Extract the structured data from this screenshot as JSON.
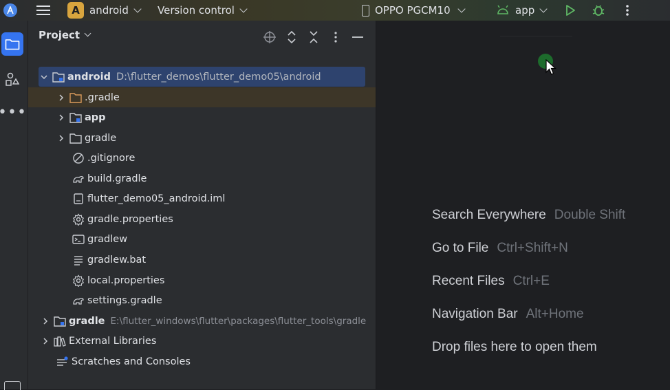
{
  "topbar": {
    "project_initial": "A",
    "project_name": "android",
    "vcs_label": "Version control",
    "device_name": "OPPO PGCM10",
    "run_config": "app",
    "icons": [
      "main-menu-icon",
      "phone-icon",
      "android-icon",
      "run-icon",
      "debug-icon",
      "more-vertical-icon"
    ]
  },
  "left_strip": {
    "items": [
      "project-tool-icon",
      "structure-icon",
      "more-tools-icon"
    ]
  },
  "panel": {
    "title": "Project",
    "header_icons": [
      "locate-icon",
      "expand-all-icon",
      "collapse-all-icon",
      "options-icon",
      "hide-icon"
    ]
  },
  "tree": {
    "root_name": "android",
    "root_path": "D:\\flutter_demos\\flutter_demo05\\android",
    "items": [
      {
        "name": ".gradle"
      },
      {
        "name": "app"
      },
      {
        "name": "gradle"
      },
      {
        "name": ".gitignore"
      },
      {
        "name": "build.gradle"
      },
      {
        "name": "flutter_demo05_android.iml"
      },
      {
        "name": "gradle.properties"
      },
      {
        "name": "gradlew"
      },
      {
        "name": "gradlew.bat"
      },
      {
        "name": "local.properties"
      },
      {
        "name": "settings.gradle"
      }
    ],
    "gradle_name": "gradle",
    "gradle_path": "E:\\flutter_windows\\flutter\\packages\\flutter_tools\\gradle",
    "external_libraries": "External Libraries",
    "scratches": "Scratches and Consoles"
  },
  "editor": {
    "hints": [
      {
        "action": "Search Everywhere",
        "shortcut": "Double Shift"
      },
      {
        "action": "Go to File",
        "shortcut": "Ctrl+Shift+N"
      },
      {
        "action": "Recent Files",
        "shortcut": "Ctrl+E"
      },
      {
        "action": "Navigation Bar",
        "shortcut": "Alt+Home"
      },
      {
        "action": "Drop files here to open them",
        "shortcut": ""
      }
    ]
  },
  "colors": {
    "accent": "#3574f0",
    "selection": "#2e436e",
    "project_badge": "#d9a53e",
    "run_green": "#5fb865",
    "folder_orange": "#d99a5b"
  }
}
